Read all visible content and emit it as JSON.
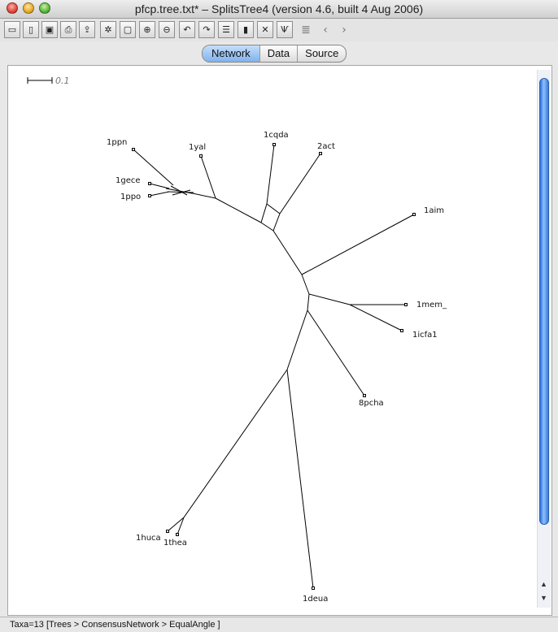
{
  "window": {
    "title": "pfcp.tree.txt* – SplitsTree4 (version 4.6, built 4 Aug 2006)"
  },
  "toolbar": {
    "buttons": [
      {
        "name": "open-icon",
        "glyph": "▭"
      },
      {
        "name": "new-document-icon",
        "glyph": "▯"
      },
      {
        "name": "save-icon",
        "glyph": "▣"
      },
      {
        "name": "print-icon",
        "glyph": "⎙"
      },
      {
        "name": "export-icon",
        "glyph": "⇪"
      },
      {
        "name": "find-icon",
        "glyph": "✲"
      },
      {
        "name": "zoom-fit-icon",
        "glyph": "▢"
      },
      {
        "name": "zoom-in-icon",
        "glyph": "⊕"
      },
      {
        "name": "zoom-out-icon",
        "glyph": "⊖"
      },
      {
        "name": "undo-icon",
        "glyph": "↶"
      },
      {
        "name": "redo-icon",
        "glyph": "↷"
      },
      {
        "name": "list-icon",
        "glyph": "☰"
      },
      {
        "name": "window-icon",
        "glyph": "▮"
      },
      {
        "name": "network-layout-icon",
        "glyph": "✕"
      },
      {
        "name": "tree-layout-icon",
        "glyph": "Ѱ"
      },
      {
        "name": "history-icon",
        "glyph": "≣"
      },
      {
        "name": "back-icon",
        "glyph": "‹"
      },
      {
        "name": "forward-icon",
        "glyph": "›"
      }
    ]
  },
  "tabs": [
    {
      "label": "Network",
      "active": true
    },
    {
      "label": "Data",
      "active": false
    },
    {
      "label": "Source",
      "active": false
    }
  ],
  "scale": {
    "label": "0.1"
  },
  "taxa": [
    "1ppn",
    "1yal",
    "1cqda",
    "2act",
    "1gece",
    "1ppo",
    "1aim",
    "1mem_",
    "1icfa1",
    "8pcha",
    "1huca",
    "1thea",
    "1deua"
  ],
  "status": {
    "text": "Taxa=13 [Trees > ConsensusNetwork > EqualAngle ]"
  }
}
